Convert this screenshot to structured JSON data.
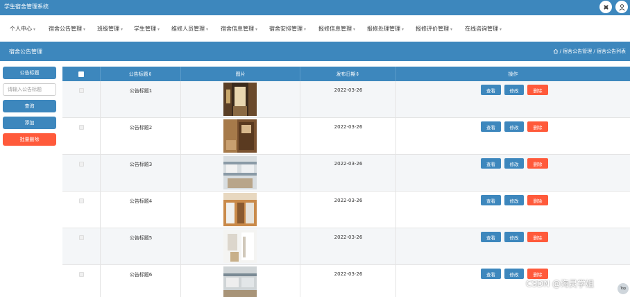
{
  "app": {
    "title": "学生宿舍管理系统"
  },
  "header_icons": [
    "settings-icon",
    "user-icon"
  ],
  "menu": [
    {
      "label": "个人中心",
      "caret": "▾"
    },
    {
      "label": "宿舍公告管理",
      "caret": "▾"
    },
    {
      "label": "班级管理",
      "caret": "▾"
    },
    {
      "label": "学生管理",
      "caret": "▾"
    },
    {
      "label": "维修人员管理",
      "caret": "▾"
    },
    {
      "label": "宿舍信息管理",
      "caret": "▾"
    },
    {
      "label": "宿舍安排管理",
      "caret": "▾"
    },
    {
      "label": "报修信息管理",
      "caret": "▾"
    },
    {
      "label": "报修处理管理",
      "caret": "▾"
    },
    {
      "label": "报修评价管理",
      "caret": "▾"
    },
    {
      "label": "在线咨询管理",
      "caret": "▾"
    }
  ],
  "page": {
    "title": "宿舍公告管理",
    "breadcrumb": "/ 宿舍公告管理 / 宿舍公告列表"
  },
  "sidebar": {
    "filter_label": "公告标题",
    "search_placeholder": "请输入公告标题",
    "query_button": "查询",
    "add_button": "添加",
    "batch_delete_button": "批量删除"
  },
  "table": {
    "columns": [
      "公告标题⇕",
      "图片",
      "发布日期⇕",
      "操作"
    ],
    "rows": [
      {
        "title": "公告标题1",
        "date": "2022-03-26"
      },
      {
        "title": "公告标题2",
        "date": "2022-03-26"
      },
      {
        "title": "公告标题3",
        "date": "2022-03-26"
      },
      {
        "title": "公告标题4",
        "date": "2022-03-26"
      },
      {
        "title": "公告标题5",
        "date": "2022-03-26"
      },
      {
        "title": "公告标题6",
        "date": "2022-03-26"
      }
    ],
    "actions": {
      "view": "查看",
      "edit": "修改",
      "delete": "删除"
    }
  },
  "watermark": "CSDN @海灵学姐",
  "back_to_top": "Top",
  "colors": {
    "primary": "#3d87bd",
    "danger": "#ff5a3b"
  }
}
